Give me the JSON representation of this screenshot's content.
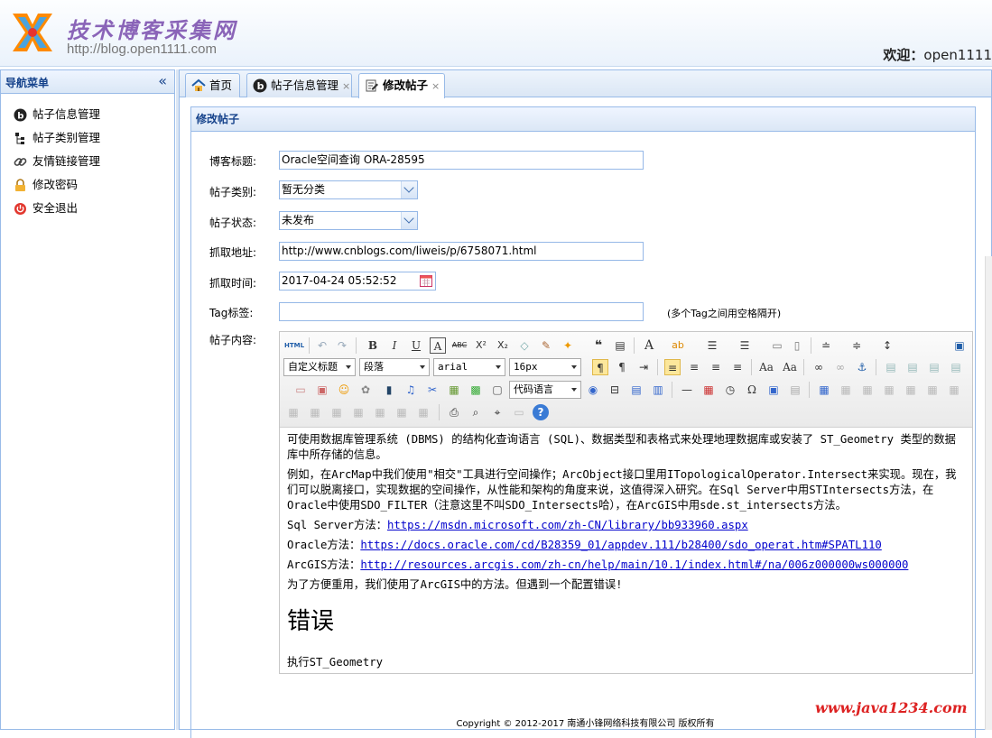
{
  "header": {
    "title": "技术博客采集网",
    "url": "http://blog.open1111.com",
    "welcome_label": "欢迎：",
    "username": "open1111"
  },
  "sidebar": {
    "title": "导航菜单",
    "collapse_icon": "«",
    "items": [
      {
        "label": "帖子信息管理",
        "icon": "b-circle-icon"
      },
      {
        "label": "帖子类别管理",
        "icon": "tree-icon"
      },
      {
        "label": "友情链接管理",
        "icon": "link-icon"
      },
      {
        "label": "修改密码",
        "icon": "lock-icon"
      },
      {
        "label": "安全退出",
        "icon": "power-icon"
      }
    ]
  },
  "tabs": [
    {
      "label": "首页",
      "icon": "home-icon",
      "closable": false
    },
    {
      "label": "帖子信息管理",
      "icon": "b-circle-icon",
      "closable": true
    },
    {
      "label": "修改帖子",
      "icon": "edit-icon",
      "closable": true
    }
  ],
  "tab_close": "×",
  "panel": {
    "title": "修改帖子"
  },
  "form": {
    "title_label": "博客标题:",
    "title_value": "Oracle空间查询 ORA-28595",
    "category_label": "帖子类别:",
    "category_value": "暂无分类",
    "status_label": "帖子状态:",
    "status_value": "未发布",
    "url_label": "抓取地址:",
    "url_value": "http://www.cnblogs.com/liweis/p/6758071.html",
    "time_label": "抓取时间:",
    "time_value": "2017-04-24 05:52:52",
    "tag_label": "Tag标签:",
    "tag_value": "",
    "tag_hint": "(多个Tag之间用空格隔开)",
    "content_label": "帖子内容:"
  },
  "editor": {
    "selects": {
      "custom_title": "自定义标题",
      "paragraph": "段落",
      "font_family": "arial",
      "font_size": "16px",
      "code_language": "代码语言"
    },
    "content": {
      "p1": "可使用数据库管理系统 (DBMS) 的结构化查询语言 (SQL)、数据类型和表格式来处理地理数据库或安装了 ST_Geometry 类型的数据库中所存储的信息。",
      "p2": "例如，在ArcMap中我们使用\"相交\"工具进行空间操作；ArcObject接口里用ITopologicalOperator.Intersect来实现。现在，我们可以脱离接口，实现数据的空间操作，从性能和架构的角度来说，这值得深入研究。在Sql Server中用STIntersects方法，在Oracle中使用SDO_FILTER（注意这里不叫SDO_Intersects哈），在ArcGIS中用sde.st_intersects方法。",
      "sql_label": "Sql Server方法：",
      "sql_link": "https://msdn.microsoft.com/zh-CN/library/bb933960.aspx",
      "oracle_label": "Oracle方法：",
      "oracle_link": "https://docs.oracle.com/cd/B28359_01/appdev.111/b28400/sdo_operat.htm#SPATL110",
      "arcgis_label": "ArcGIS方法：",
      "arcgis_link": "http://resources.arcgis.com/zh-cn/help/main/10.1/index.html#/na/006z000000ws000000",
      "p3": "为了方便重用，我们使用了ArcGIS中的方法。但遇到一个配置错误!",
      "heading": "错误",
      "p4": "执行ST_Geometry"
    }
  },
  "footer": {
    "text": "Copyright © 2012-2017 南通小锋网络科技有限公司 版权所有"
  },
  "watermark": "www.java1234.com"
}
